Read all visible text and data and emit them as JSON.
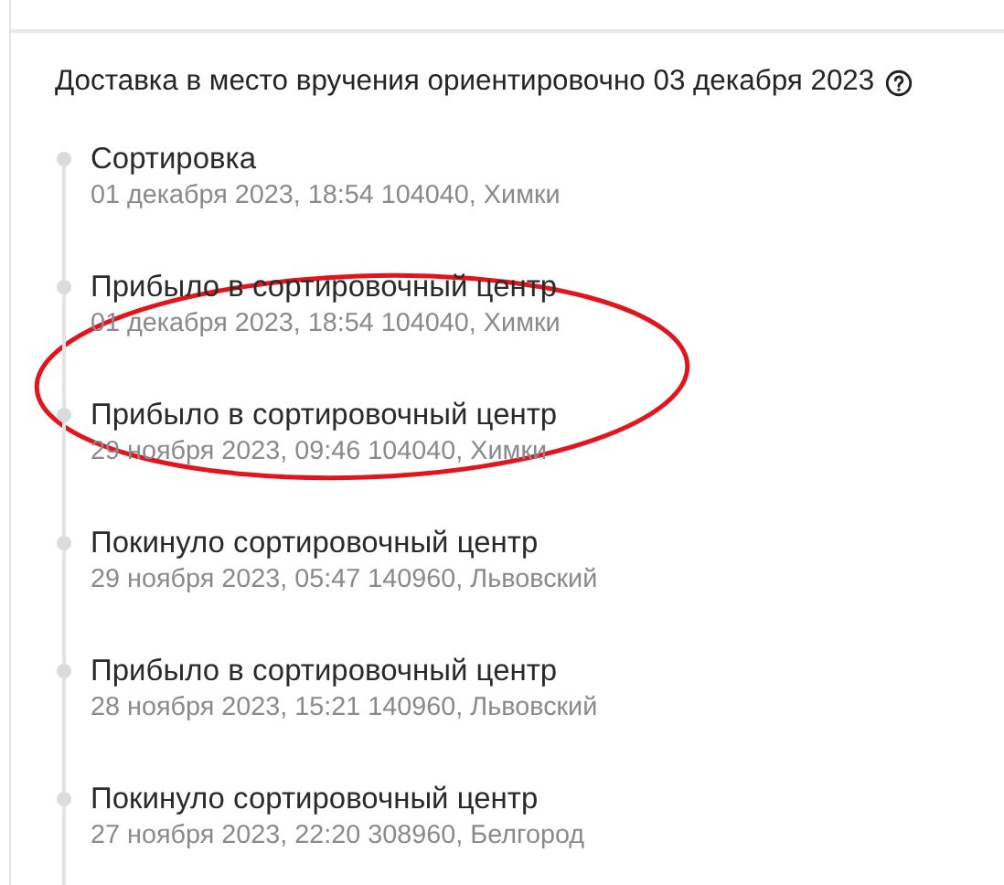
{
  "header": {
    "text": "Доставка в место вручения ориентировочно 03 декабря 2023"
  },
  "events": [
    {
      "title": "Сортировка",
      "details": "01 декабря 2023, 18:54 104040, Химки"
    },
    {
      "title": "Прибыло в сортировочный центр",
      "details": "01 декабря 2023, 18:54 104040, Химки"
    },
    {
      "title": "Прибыло в сортировочный центр",
      "details": "29 ноября 2023, 09:46 104040, Химки"
    },
    {
      "title": "Покинуло сортировочный центр",
      "details": "29 ноября 2023, 05:47 140960, Львовский"
    },
    {
      "title": "Прибыло в сортировочный центр",
      "details": "28 ноября 2023, 15:21 140960, Львовский"
    },
    {
      "title": "Покинуло сортировочный центр",
      "details": "27 ноября 2023, 22:20 308960, Белгород"
    }
  ],
  "annotation": {
    "kind": "ellipse",
    "color": "#e3141c"
  }
}
